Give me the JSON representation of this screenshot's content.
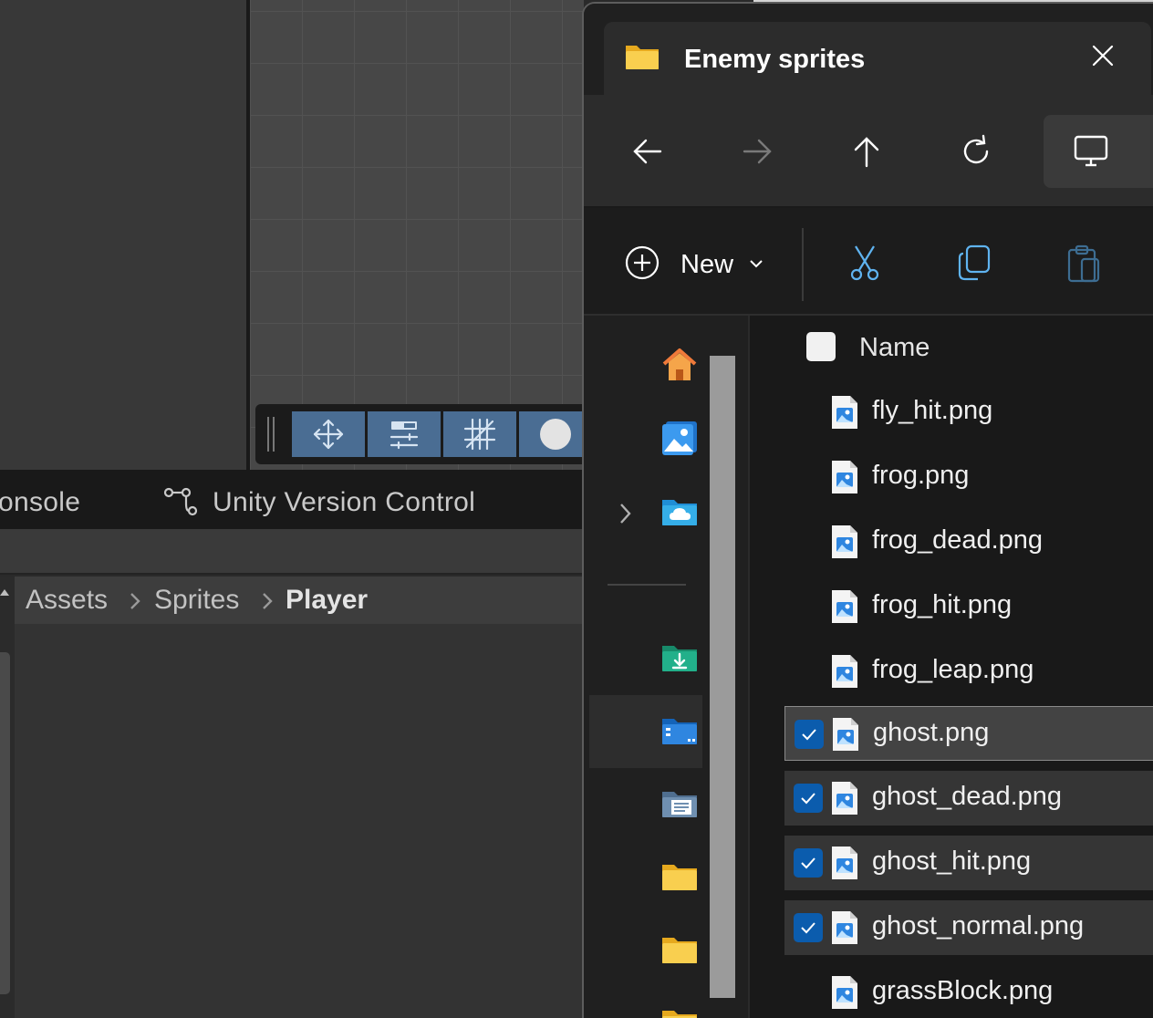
{
  "unity": {
    "tabs": {
      "console_label": "onsole",
      "version_control_label": "Unity Version Control"
    },
    "breadcrumb": [
      "Assets",
      "Sprites",
      "Player"
    ],
    "toolbar_tools": [
      "move-tool-icon",
      "sliders-tool-icon",
      "grid-snap-tool-icon",
      "sphere-tool-icon"
    ]
  },
  "explorer": {
    "tab_title": "Enemy sprites",
    "command_bar": {
      "new_label": "New"
    },
    "list": {
      "header_name": "Name",
      "files": [
        {
          "name": "fly_hit.png",
          "selected": false
        },
        {
          "name": "frog.png",
          "selected": false
        },
        {
          "name": "frog_dead.png",
          "selected": false
        },
        {
          "name": "frog_hit.png",
          "selected": false
        },
        {
          "name": "frog_leap.png",
          "selected": false
        },
        {
          "name": "ghost.png",
          "selected": true
        },
        {
          "name": "ghost_dead.png",
          "selected": true
        },
        {
          "name": "ghost_hit.png",
          "selected": true
        },
        {
          "name": "ghost_normal.png",
          "selected": true
        },
        {
          "name": "grassBlock.png",
          "selected": false
        }
      ]
    },
    "nav_pane_icons": [
      "home-icon",
      "gallery-icon",
      "onedrive-icon",
      "downloads-icon",
      "desktop-icon",
      "documents-icon",
      "folder-icon",
      "folder-icon",
      "folder-icon"
    ],
    "colors": {
      "accent": "#0b5cad",
      "folder": "#f6c54a"
    }
  }
}
